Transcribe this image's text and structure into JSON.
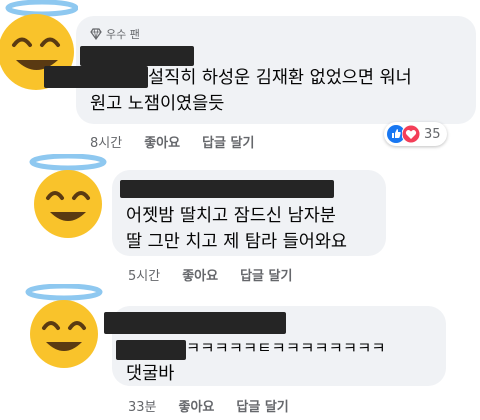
{
  "comments": [
    {
      "badge": "우수 팬",
      "text_lines": [
        "설직히 하성운 김재환 없었으면 워너",
        "원고 노잼이였을듯"
      ],
      "time": "8시간",
      "like_label": "좋아요",
      "reply_label": "답글 달기",
      "reactions": {
        "icons": [
          "like-icon",
          "love-icon"
        ],
        "count": "35"
      }
    },
    {
      "text_lines": [
        "어젯밤 딸치고 잠드신 남자분",
        "딸 그만 치고 제 탐라 들어와요"
      ],
      "time": "5시간",
      "like_label": "좋아요",
      "reply_label": "답글 달기"
    },
    {
      "text_lines": [
        "ㅋㅋㅋㅋㅋㅌㅋㅋㅋㅋㅋㅋㅋㅋ",
        "댓굴바"
      ],
      "time": "33분",
      "like_label": "좋아요",
      "reply_label": "답글 달기"
    }
  ],
  "colors": {
    "bubble": "#f0f2f5",
    "meta_text": "#65676b",
    "like_blue": "#1877f2",
    "love_red": "#f33e58",
    "emoji_face": "#f9c32b",
    "halo": "#8ec8f0"
  }
}
